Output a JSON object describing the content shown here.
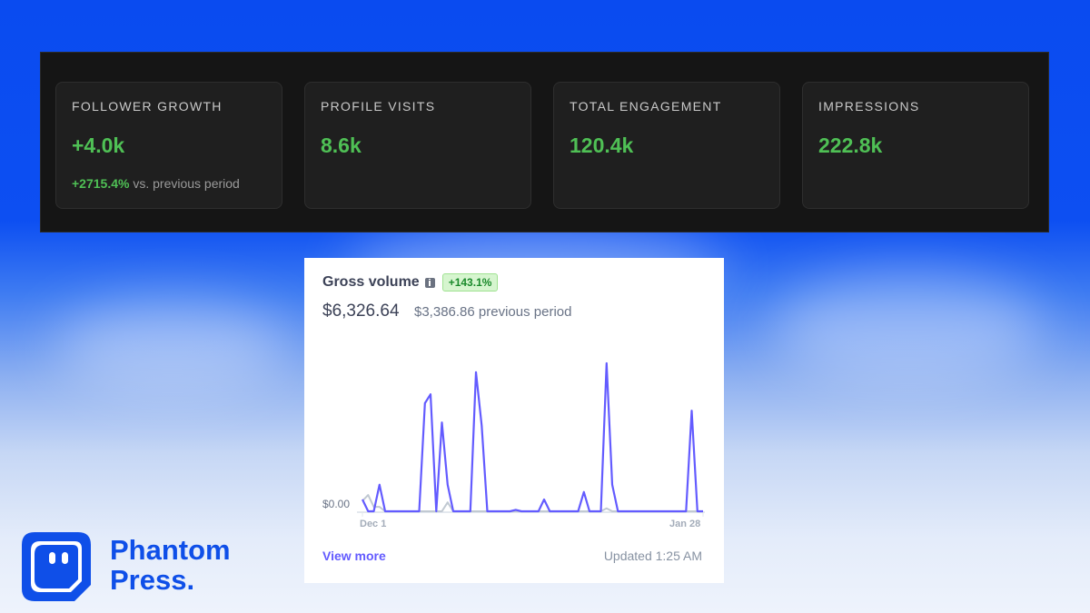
{
  "stats": [
    {
      "label": "FOLLOWER GROWTH",
      "value": "+4.0k",
      "change": "+2715.4%",
      "change_suffix": "vs. previous period"
    },
    {
      "label": "PROFILE VISITS",
      "value": "8.6k"
    },
    {
      "label": "TOTAL ENGAGEMENT",
      "value": "120.4k"
    },
    {
      "label": "IMPRESSIONS",
      "value": "222.8k"
    }
  ],
  "gross_volume": {
    "title": "Gross volume",
    "badge": "+143.1%",
    "amount": "$6,326.64",
    "previous": "$3,386.86 previous period",
    "zero_label": "$0.00",
    "view_more": "View more",
    "updated": "Updated 1:25 AM"
  },
  "chart_data": {
    "type": "line",
    "x_tick_labels": [
      "Dec 1",
      "Jan 28"
    ],
    "y_tick_labels": [
      "$0.00"
    ],
    "ylim": [
      0,
      100
    ],
    "grid": false,
    "series": [
      {
        "color": "#635bff",
        "values": [
          8,
          0,
          0,
          18,
          0,
          0,
          0,
          0,
          0,
          0,
          0,
          73,
          79,
          0,
          60,
          18,
          0,
          0,
          0,
          0,
          94,
          58,
          0,
          0,
          0,
          0,
          0,
          1,
          0,
          0,
          0,
          0,
          8,
          0,
          0,
          0,
          0,
          0,
          0,
          13,
          0,
          0,
          0,
          100,
          18,
          0,
          0,
          0,
          0,
          0,
          0,
          0,
          0,
          0,
          0,
          0,
          0,
          0,
          68,
          0,
          0
        ]
      },
      {
        "color": "#c1c9d2",
        "values": [
          7,
          11,
          3,
          3,
          0,
          0,
          0,
          0,
          0,
          0,
          0,
          0,
          0,
          0,
          0,
          6,
          0,
          0,
          0,
          0,
          0,
          0,
          0,
          0,
          0,
          0,
          0,
          0,
          0,
          0,
          0,
          0,
          0,
          0,
          0,
          0,
          0,
          0,
          0,
          0,
          0,
          0,
          0,
          2,
          0,
          0,
          0,
          0,
          0,
          0,
          0,
          0,
          0,
          0,
          0,
          0,
          0,
          0,
          0,
          0,
          0
        ]
      }
    ],
    "colors": {
      "current": "#635bff",
      "previous": "#c1c9d2",
      "axis": "#e3e8ee"
    }
  },
  "logo": {
    "line1": "Phantom",
    "line2": "Press."
  },
  "colors": {
    "accent_green": "#4fc055",
    "brand_blue": "#0f4fe8",
    "badge_green": "#1a8a2b"
  }
}
